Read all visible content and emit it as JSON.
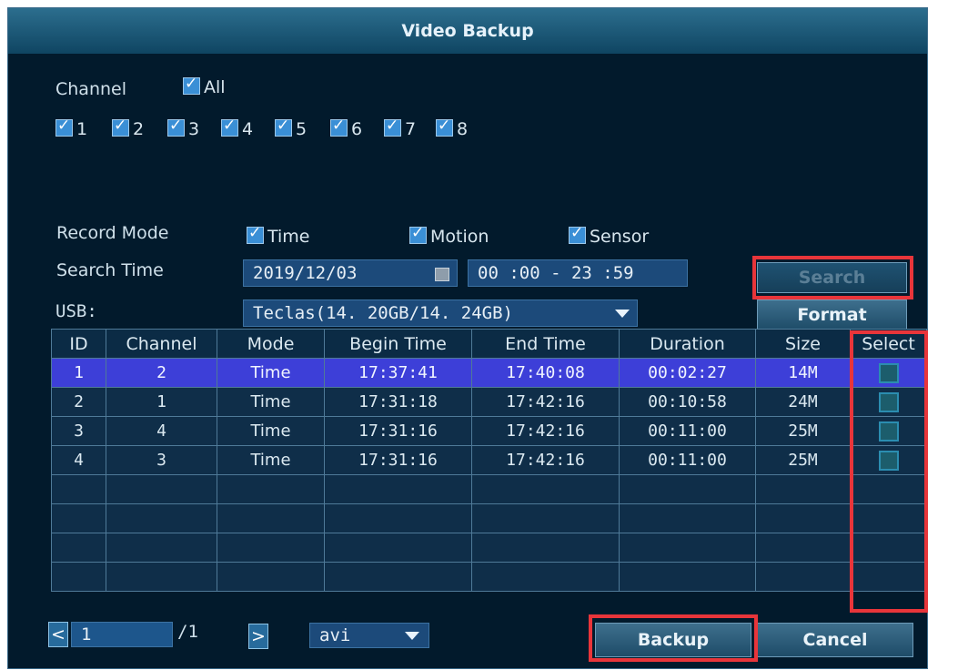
{
  "window": {
    "title": "Video Backup"
  },
  "channel": {
    "label": "Channel",
    "all_label": "All",
    "items": [
      "1",
      "2",
      "3",
      "4",
      "5",
      "6",
      "7",
      "8"
    ]
  },
  "record_mode": {
    "label": "Record Mode",
    "options": [
      "Time",
      "Motion",
      "Sensor"
    ]
  },
  "search_time": {
    "label": "Search Time",
    "date": "2019/12/03",
    "time_range": "00 :00 - 23 :59"
  },
  "usb": {
    "label": "USB:",
    "value": "Teclas(14. 20GB/14. 24GB)"
  },
  "buttons": {
    "search": "Search",
    "format": "Format",
    "backup": "Backup",
    "cancel": "Cancel"
  },
  "table": {
    "headers": [
      "ID",
      "Channel",
      "Mode",
      "Begin Time",
      "End Time",
      "Duration",
      "Size",
      "Select"
    ],
    "rows": [
      {
        "id": "1",
        "channel": "2",
        "mode": "Time",
        "begin": "17:37:41",
        "end": "17:40:08",
        "duration": "00:02:27",
        "size": "14M"
      },
      {
        "id": "2",
        "channel": "1",
        "mode": "Time",
        "begin": "17:31:18",
        "end": "17:42:16",
        "duration": "00:10:58",
        "size": "24M"
      },
      {
        "id": "3",
        "channel": "4",
        "mode": "Time",
        "begin": "17:31:16",
        "end": "17:42:16",
        "duration": "00:11:00",
        "size": "25M"
      },
      {
        "id": "4",
        "channel": "3",
        "mode": "Time",
        "begin": "17:31:16",
        "end": "17:42:16",
        "duration": "00:11:00",
        "size": "25M"
      }
    ]
  },
  "pager": {
    "prev_icon": "<",
    "next_icon": ">",
    "page_value": "1",
    "total": "/1",
    "format_value": "avi"
  },
  "colors": {
    "background": "#021a2c",
    "selected_row": "#3d3fd8",
    "highlight_red": "#e8353a",
    "checkbox": "#3a8fd6"
  }
}
